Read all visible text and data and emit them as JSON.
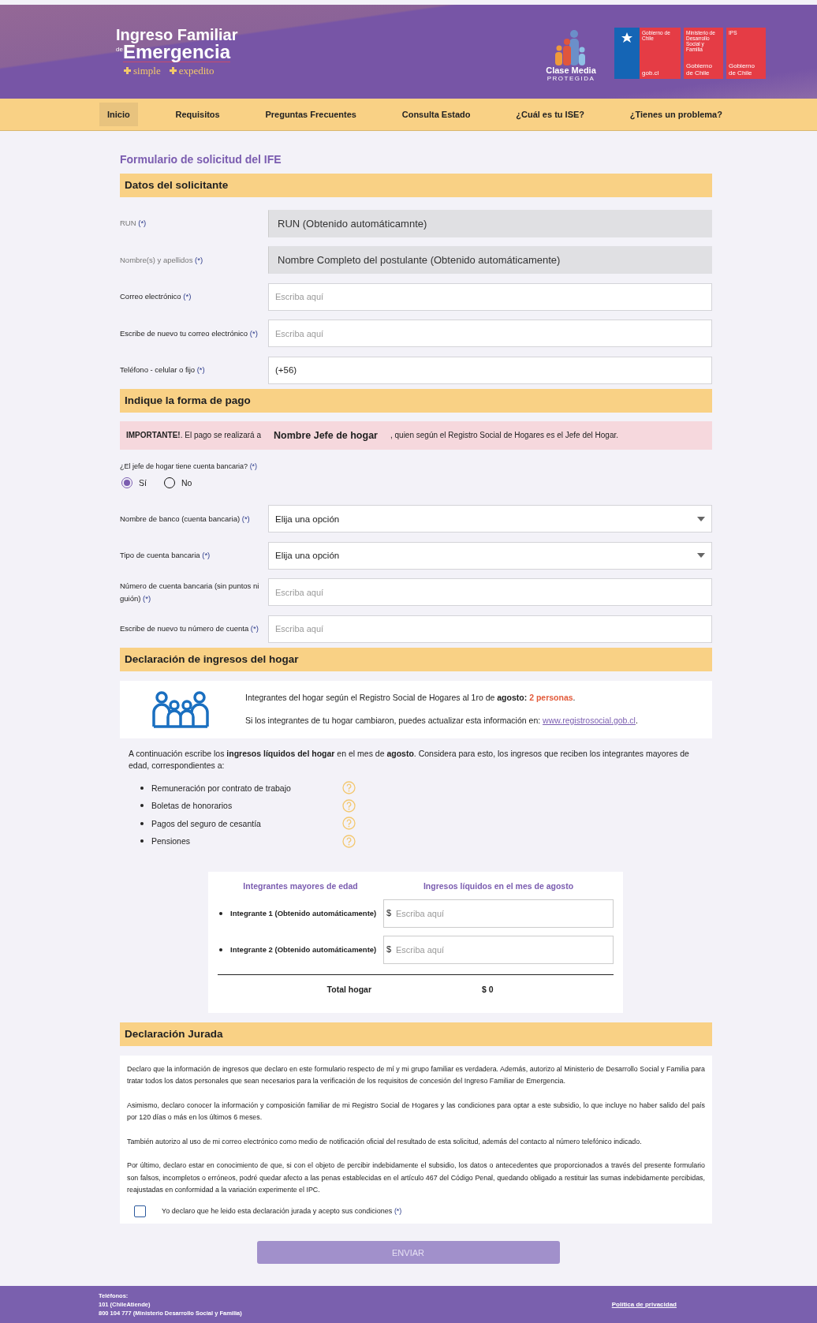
{
  "header": {
    "logo": {
      "line1": "Ingreso Familiar",
      "prefix": "de",
      "line2": "Emergencia",
      "taglines": [
        "simple",
        "expedito"
      ]
    },
    "partner_logo": {
      "title": "Clase Media",
      "subtitle": "PROTEGIDA"
    },
    "gov_tiles": [
      {
        "kind": "emblem",
        "title": "Gobierno de Chile",
        "footer": "gob.cl"
      },
      {
        "kind": "text",
        "title": "Ministerio de Desarrollo Social y Familia",
        "footer": "Gobierno de Chile"
      },
      {
        "kind": "text",
        "title": "IPS",
        "footer": "Gobierno de Chile"
      }
    ]
  },
  "nav": [
    {
      "label": "Inicio",
      "selected": true
    },
    {
      "label": "Requisitos",
      "selected": false
    },
    {
      "label": "Preguntas Frecuentes",
      "selected": false
    },
    {
      "label": "Consulta Estado",
      "selected": false
    },
    {
      "label": "¿Cuál es tu ISE?",
      "selected": false
    },
    {
      "label": "¿Tienes un problema?",
      "selected": false
    }
  ],
  "form": {
    "title": "Formulario de solicitud del IFE",
    "applicant": {
      "heading": "Datos del solicitante",
      "fields": [
        {
          "kind": "readonly",
          "label": "RUN",
          "mark": "(*)",
          "value": "RUN (Obtenido automáticamnte)"
        },
        {
          "kind": "readonly",
          "label": "Nombre(s) y apellidos",
          "mark": "(*)",
          "value": "Nombre Completo del postulante (Obtenido automáticamente)"
        },
        {
          "kind": "input",
          "label": "Correo electrónico",
          "mark": "(*)",
          "placeholder": "Escriba aquí"
        },
        {
          "kind": "input",
          "label": "Escribe de nuevo tu correo electrónico",
          "mark": "(*)",
          "placeholder": "Escriba aquí"
        },
        {
          "kind": "input",
          "label": "Teléfono - celular o fijo",
          "mark": "(*)",
          "value": "(+56)"
        }
      ]
    },
    "payment": {
      "heading": "Indique la forma de pago",
      "notice": {
        "before": "**IMPORTANTE!**. El pago se realizará a",
        "name": "Nombre Jefe de hogar",
        "after": ", quien según el Registro Social de Hogares es el Jefe del Hogar."
      },
      "question": {
        "label": "¿El jefe de hogar tiene cuenta bancaria?",
        "mark": "(*)"
      },
      "options": [
        {
          "label": "Sí",
          "selected": true
        },
        {
          "label": "No",
          "selected": false
        }
      ],
      "fields": [
        {
          "kind": "select",
          "label": "Nombre de banco (cuenta bancaria)",
          "mark": "(*)",
          "value": "Elija una opción"
        },
        {
          "kind": "select",
          "label": "Tipo de cuenta bancaria",
          "mark": "(*)",
          "value": "Elija una opción"
        },
        {
          "kind": "input",
          "label": "Número de cuenta bancaria (sin puntos ni guión)",
          "mark": "(*)",
          "placeholder": "Escriba aquí"
        },
        {
          "kind": "input",
          "label": "Escribe de nuevo tu número de cuenta",
          "mark": "(*)",
          "placeholder": "Escriba aquí"
        }
      ]
    },
    "income": {
      "heading": "Declaración de ingresos del hogar",
      "info": {
        "members_text": "Integrantes del hogar según el Registro Social de Hogares al 1ro de **agosto:**",
        "members_count": "2 personas",
        "members_end": ".",
        "update_text": "Si los integrantes de tu hogar cambiaron, puedes actualizar esta información en:",
        "update_link": "www.registrosocial.gob.cl",
        "update_end": "."
      },
      "intro": "A continuación escribe los **ingresos líquidos del hogar** en el mes de **agosto**. Considera para esto, los ingresos que reciben los integrantes mayores de edad, correspondientes a:",
      "sources": [
        "Remuneración por contrato de trabajo",
        "Boletas de honorarios",
        "Pagos del seguro de cesantía",
        "Pensiones"
      ],
      "table": {
        "columns": [
          "Integrantes mayores de edad",
          "Ingresos líquidos en el mes de agosto"
        ],
        "rows": [
          {
            "member": "Integrante 1 (Obtenido automáticamente)",
            "currency": "$",
            "placeholder": "Escriba aquí"
          },
          {
            "member": "Integrante 2 (Obtenido automáticamente)",
            "currency": "$",
            "placeholder": "Escriba aquí"
          }
        ],
        "total_label": "Total hogar",
        "total_value": "$ 0"
      }
    },
    "declaration": {
      "heading": "Declaración Jurada",
      "paragraphs": [
        "Declaro que la información de ingresos que declaro en este formulario respecto de mí y mi grupo familiar es verdadera. Además, autorizo al Ministerio de Desarrollo Social y Familia para tratar todos los datos personales que sean necesarios para la verificación de los requisitos de concesión del Ingreso Familiar de Emergencia.",
        "Asimismo, declaro conocer la información y composición familiar de mi Registro Social de Hogares y las condiciones para optar a este subsidio, lo que incluye no haber salido del país por 120 días o más en los últimos 6 meses.",
        "También autorizo al uso de mi correo electrónico como medio de notificación oficial del resultado de esta solicitud, además del contacto al número telefónico indicado.",
        "Por último, declaro estar en conocimiento de que, si con el objeto de percibir indebidamente el subsidio, los datos o antecedentes que proporcionados a través del presente formulario son falsos, incompletos o erróneos, podré quedar afecto a las penas establecidas en el artículo 467 del Código Penal, quedando obligado a restituir las sumas indebidamente percibidas, reajustadas en conformidad a la variación experimente el IPC."
      ],
      "accept": {
        "label": "Yo declaro que he leido esta declaración jurada y acepto sus condiciones",
        "mark": "(*)",
        "checked": false
      }
    },
    "submit": {
      "label": "ENVIAR",
      "disabled": true
    }
  },
  "footer": {
    "phones_title": "Teléfonos:",
    "phones": [
      "101 (ChileAtiende)",
      "800 104 777 (Ministerio Desarrollo Social y Familia)"
    ],
    "privacy_link": "Política de privacidad"
  }
}
